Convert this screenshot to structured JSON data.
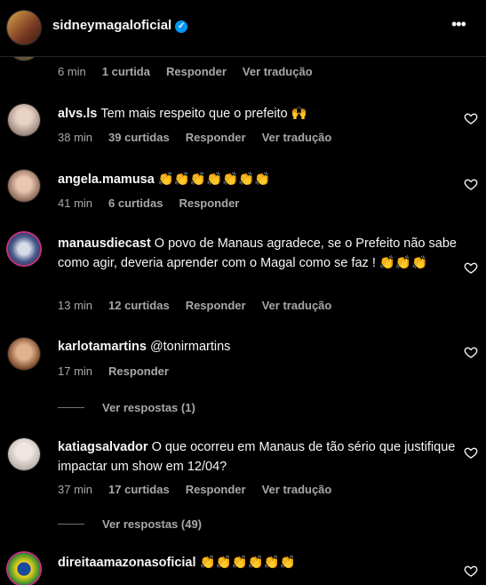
{
  "header": {
    "username": "sidneymagaloficial"
  },
  "partial_comment": {
    "time": "6 min",
    "likes": "1 curtida",
    "reply": "Responder",
    "translate": "Ver tradução"
  },
  "comments": [
    {
      "user": "alvs.ls",
      "text": "Tem mais respeito que o prefeito 🙌",
      "time": "38 min",
      "likes": "39 curtidas",
      "reply": "Responder",
      "translate": "Ver tradução"
    },
    {
      "user": "angela.mamusa",
      "text": "👏👏👏👏👏👏👏",
      "time": "41 min",
      "likes": "6 curtidas",
      "reply": "Responder"
    },
    {
      "user": "manausdiecast",
      "text": "O povo de Manaus agradece, se o Prefeito não sabe como agir, deveria aprender com o Magal como se faz ! 👏👏👏",
      "time": "13 min",
      "likes": "12 curtidas",
      "reply": "Responder",
      "translate": "Ver tradução"
    },
    {
      "user": "karlotamartins",
      "text": "@tonirmartins",
      "time": "17 min",
      "reply": "Responder",
      "view_replies": "Ver respostas (1)"
    },
    {
      "user": "katiagsalvador",
      "text": "O que ocorreu em Manaus de tão sério que justifique impactar um show em 12/04?",
      "time": "37 min",
      "likes": "17 curtidas",
      "reply": "Responder",
      "translate": "Ver tradução",
      "view_replies": "Ver respostas (49)"
    },
    {
      "user": "direitaamazonasoficial",
      "text": "👏👏👏👏👏👏"
    }
  ],
  "colors": {
    "background": "#000000",
    "text": "#f5f5f5",
    "muted": "#a8a8a8",
    "verified": "#0095f6"
  }
}
